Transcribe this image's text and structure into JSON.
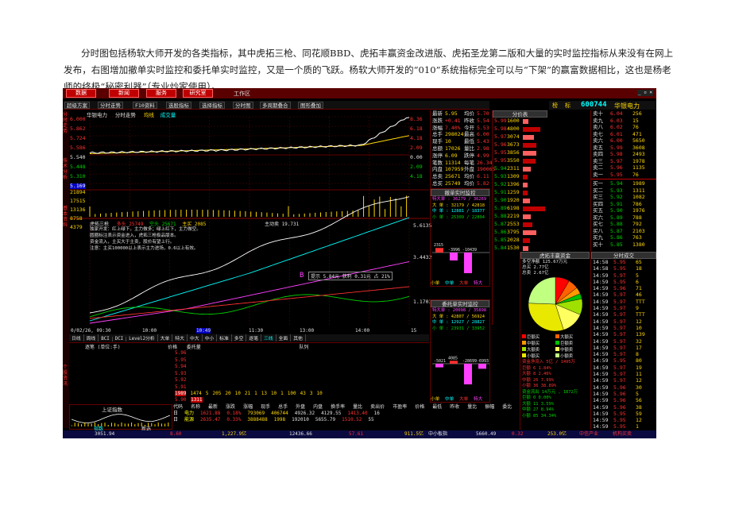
{
  "caption": "分时图包括杨软大师开发的各类指标，其中虎拓三枪、同花顺BBD、虎拓丰赢资金改进版、虎拓圣龙第二版和大量的实时监控指标从来没有在网上发布，右图增加撤单实时监控和委托单实时监控，又是一个质的飞跃。杨软大师开发的“010”系统指标完全可以与“下架”的赢富数据相比，这也是杨老师的终极“秘密利器”（专业炒家使用）。",
  "colors": {
    "up": "#ff3030",
    "down": "#00d000",
    "price": "#ffffff",
    "avg": "#ffd700",
    "volume": "#ffd700",
    "bg": "#000000"
  },
  "topbar": {
    "buttons": [
      "数据",
      "新闻",
      "服务",
      "研究室"
    ],
    "workspace": "工作区"
  },
  "stock": {
    "code": "600744",
    "name": "华银电力",
    "tabs": [
      "榜",
      "标"
    ]
  },
  "toolbar": [
    "超级方案",
    "分时走势",
    "F10资料",
    "选股指标",
    "选择指标",
    "分时图",
    "多周期叠合",
    "图形叠加"
  ],
  "chart_header": {
    "name": "华银电力",
    "mode": "分时走势",
    "tags": [
      "均线",
      "成交量"
    ]
  },
  "price_axis": {
    "left": [
      "6.000",
      "5.862",
      "5.724",
      "5.586",
      "5.448",
      "5.310",
      "5.169"
    ],
    "right": [
      "8.36",
      "6.18",
      "4.18",
      "2.09",
      "0.00",
      "2.09",
      "4.18"
    ],
    "current_left": "5.540",
    "current_right": "0.00",
    "volume": [
      "21894",
      "17515",
      "13136",
      "8758",
      "4379"
    ]
  },
  "indicator_header": {
    "label": "虎拓三枪",
    "items": [
      "多头 25749",
      "空头 25671",
      "主买 2085"
    ],
    "right_vals": [
      "3.4454",
      "主动卖 19.731"
    ]
  },
  "indicator_text": [
    "独家开发：红上绿下，主力做多；绿上红下，主力做空。",
    "圆圈标注表示资金进入，虎拓三枪极品版本。",
    "资金流入，主买大于主卖，股价有望上行。",
    "注意：主买100000以上表示主力进场，0.6以上有效。"
  ],
  "indicator_right_axis": [
    "5.6135",
    "3.4432",
    "1.1703",
    "0"
  ],
  "marker": {
    "letter": "B",
    "note": "提示 5.84元 获利 0.31元 占 21%"
  },
  "time_axis": [
    "0/02/26, 09:30",
    "10:00",
    "10:49",
    "11:30",
    "13:00",
    "14:00",
    "15"
  ],
  "bottom_tabs": [
    "日线",
    "周线",
    "BCI",
    "DCI",
    "Level2分析",
    "大单",
    "特大",
    "中大",
    "中小",
    "标准",
    "多空",
    "逐笔",
    "三线",
    "全面",
    "其他"
  ],
  "stats": [
    {
      "k": "最新",
      "v": "5.95",
      "k2": "均价",
      "v2": "5.70"
    },
    {
      "k": "涨跌",
      "v": "+0.41",
      "k2": "昨收",
      "v2": "5.54"
    },
    {
      "k": "涨幅",
      "v": "7.40%",
      "k2": "今开",
      "v2": "5.53"
    },
    {
      "k": "总手",
      "v": "298024",
      "k2": "最高",
      "v2": "6.00"
    },
    {
      "k": "现手",
      "v": "10",
      "k2": "最低",
      "v2": "5.43"
    },
    {
      "k": "总额",
      "v": "17026",
      "k2": "量比",
      "v2": "2.98"
    },
    {
      "k": "涨停",
      "v": "6.09",
      "k2": "跌停",
      "v2": "4.99"
    },
    {
      "k": "笔数",
      "v": "11314",
      "k2": "每笔",
      "v2": "26.34"
    },
    {
      "k": "内盘",
      "v": "107959",
      "k2": "外盘",
      "v2": "190065"
    },
    {
      "k": "总卖",
      "v": "25671",
      "k2": "均价",
      "v2": "6.11"
    },
    {
      "k": "总买",
      "v": "25749",
      "k2": "均价",
      "v2": "5.82"
    }
  ],
  "level_head": "分价表",
  "asks": [
    {
      "p": "5.99",
      "v": "1600"
    },
    {
      "p": "5.98",
      "v": "4800"
    },
    {
      "p": "5.97",
      "v": "3074"
    },
    {
      "p": "5.96",
      "v": "3673"
    },
    {
      "p": "5.95",
      "v": "3856"
    },
    {
      "p": "5.95",
      "v": "3550"
    }
  ],
  "bids": [
    {
      "p": "5.94",
      "v": "2311"
    },
    {
      "p": "5.93",
      "v": "1309"
    },
    {
      "p": "5.92",
      "v": "1396"
    },
    {
      "p": "5.91",
      "v": "1259"
    },
    {
      "p": "5.90",
      "v": "1920"
    },
    {
      "p": "5.89",
      "v": "6198"
    },
    {
      "p": "5.88",
      "v": "2219"
    },
    {
      "p": "5.87",
      "v": "2553"
    },
    {
      "p": "5.86",
      "v": "3795"
    },
    {
      "p": "5.85",
      "v": "2028"
    },
    {
      "p": "5.84",
      "v": "1530"
    }
  ],
  "orderbook": {
    "sell": [
      {
        "l": "卖十",
        "p": "6.04",
        "v": "256"
      },
      {
        "l": "卖九",
        "p": "6.03",
        "v": "15"
      },
      {
        "l": "卖八",
        "p": "6.02",
        "v": "76"
      },
      {
        "l": "卖七",
        "p": "6.01",
        "v": "471"
      },
      {
        "l": "卖六",
        "p": "6.00",
        "v": "5650"
      },
      {
        "l": "卖五",
        "p": "5.99",
        "v": "3608"
      },
      {
        "l": "卖四",
        "p": "5.98",
        "v": "2493"
      },
      {
        "l": "卖三",
        "p": "5.97",
        "v": "1978"
      },
      {
        "l": "卖二",
        "p": "5.96",
        "v": "1135"
      },
      {
        "l": "卖一",
        "p": "5.95",
        "v": "76"
      }
    ],
    "buy": [
      {
        "l": "买一",
        "p": "5.94",
        "v": "1989"
      },
      {
        "l": "买二",
        "p": "5.93",
        "v": "1311"
      },
      {
        "l": "买三",
        "p": "5.92",
        "v": "1082"
      },
      {
        "l": "买四",
        "p": "5.91",
        "v": "786"
      },
      {
        "l": "买五",
        "p": "5.90",
        "v": "1976"
      },
      {
        "l": "买六",
        "p": "5.89",
        "v": "788"
      },
      {
        "l": "买七",
        "p": "5.88",
        "v": "792"
      },
      {
        "l": "买八",
        "p": "5.87",
        "v": "2103"
      },
      {
        "l": "买九",
        "p": "5.86",
        "v": "763"
      },
      {
        "l": "买十",
        "p": "5.85",
        "v": "1380"
      }
    ]
  },
  "cancel_monitor": {
    "title": "撤单实时监控",
    "rows": [
      "特大单 : 36279 / 36269",
      "大 单 : 32179 / 42818",
      "中 单 : 12881 / 18377",
      "小 单 : 25309 / 22894"
    ],
    "bar_vals": [
      "2315",
      "-3996",
      "-10439"
    ],
    "bar_labels": [
      "小单",
      "中单",
      "大单",
      "特大"
    ]
  },
  "order_monitor": {
    "title": "委托单实时监控",
    "rows": [
      "特大单 : 20098 / 35898",
      "大 单 : 42807 / 56924",
      "中 单 : 12927 / 28827",
      "小 单 : 23931 / 33952"
    ],
    "bar_vals": [
      "-5021",
      "4085",
      "-28699",
      "-6993"
    ],
    "bar_labels": [
      "小单",
      "中单",
      "大单",
      "特大"
    ]
  },
  "fund_pie": {
    "title": "虎拓丰赢资金",
    "text": [
      "多空净额 125.67万元",
      "总买 2.77亿",
      "总卖 2.67亿"
    ],
    "legend": [
      "巨额买",
      "大额买",
      "中额买",
      "巨额卖",
      "大额卖",
      "中额卖",
      "小额买",
      "小额卖"
    ],
    "slices": [
      8.5,
      6.1,
      4.0,
      3.2,
      9.6,
      13.7,
      30.5,
      24.4
    ]
  },
  "fund_table": {
    "header": "资金净流入 5亿 / 1495万",
    "rows": [
      {
        "l": "巨额",
        "a": "6",
        "b": "1.84%"
      },
      {
        "l": "大额",
        "a": "8",
        "b": "2.46%"
      },
      {
        "l": "中额",
        "a": "26",
        "b": "7.99%"
      },
      {
        "l": "小额",
        "a": "36",
        "b": "38.89%"
      }
    ],
    "header2": "资金流出 14万元 , 1872万",
    "rows2": [
      {
        "l": "巨额",
        "a": "0",
        "b": "0.00%"
      },
      {
        "l": "大额",
        "a": "11",
        "b": "3.59%"
      },
      {
        "l": "中额",
        "a": "27",
        "b": "8.94%"
      },
      {
        "l": "小额",
        "a": "85",
        "b": "34.34%"
      }
    ]
  },
  "ticks_title": "分时成交",
  "ticks": [
    {
      "t": "14:58",
      "p": "5.95",
      "v": "65"
    },
    {
      "t": "14:58",
      "p": "5.95",
      "v": "18"
    },
    {
      "t": "14:59",
      "p": "5.97",
      "v": "5"
    },
    {
      "t": "14:59",
      "p": "5.95",
      "v": "6"
    },
    {
      "t": "14:59",
      "p": "5.96",
      "v": "71"
    },
    {
      "t": "14:59",
      "p": "5.97",
      "v": "46"
    },
    {
      "t": "14:59",
      "p": "5.97",
      "v": "TTT"
    },
    {
      "t": "14:59",
      "p": "5.97",
      "v": "9"
    },
    {
      "t": "14:59",
      "p": "5.97",
      "v": "TTT"
    },
    {
      "t": "14:59",
      "p": "5.97",
      "v": "12"
    },
    {
      "t": "14:59",
      "p": "5.97",
      "v": "10"
    },
    {
      "t": "14:59",
      "p": "5.97",
      "v": "139"
    },
    {
      "t": "14:59",
      "p": "5.97",
      "v": "32"
    },
    {
      "t": "14:59",
      "p": "5.97",
      "v": "17"
    },
    {
      "t": "14:59",
      "p": "5.97",
      "v": "8"
    },
    {
      "t": "14:59",
      "p": "5.95",
      "v": "80"
    },
    {
      "t": "14:59",
      "p": "5.97",
      "v": "19"
    },
    {
      "t": "14:59",
      "p": "5.97",
      "v": "11"
    },
    {
      "t": "14:59",
      "p": "5.97",
      "v": "12"
    },
    {
      "t": "14:59",
      "p": "5.96",
      "v": "30"
    },
    {
      "t": "14:59",
      "p": "5.96",
      "v": "5"
    },
    {
      "t": "14:59",
      "p": "5.96",
      "v": "56"
    },
    {
      "t": "14:59",
      "p": "5.96",
      "v": "38"
    },
    {
      "t": "14:59",
      "p": "5.95",
      "v": "59"
    },
    {
      "t": "14:59",
      "p": "5.95",
      "v": "12"
    },
    {
      "t": "14:59",
      "p": "5.95",
      "v": "1"
    }
  ],
  "depth": {
    "header": [
      "逐笔",
      "(单位:手)",
      "价格",
      "委托量",
      "队列",
      "买/卖"
    ],
    "prices": [
      "5.96",
      "5.95",
      "5.94",
      "5.93",
      "5.92",
      "5.91",
      "5.90"
    ],
    "queue_row": [
      "1989",
      "1474",
      "5",
      "205",
      "20",
      "10",
      "21",
      "1",
      "13",
      "10",
      "1",
      "100",
      "43",
      "3",
      "10"
    ],
    "queue_row2": [
      "1311"
    ],
    "tags": [
      "买一",
      "买二"
    ]
  },
  "index_panel": {
    "title": "上证指数",
    "value": "3051.94",
    "change": "8.60",
    "tab": "指数",
    "tab2": "新选"
  },
  "quote_table": {
    "headers": [
      "代码",
      "名称",
      "最新",
      "涨跌",
      "涨幅",
      "现手",
      "总手",
      "外盘",
      "内盘",
      "换手率",
      "量比",
      "卖出价",
      "市盈率",
      "价格",
      "最低",
      "昨收",
      "量比",
      "振幅",
      "委比"
    ],
    "rows": [
      {
        "mark": "日",
        "name": "电力",
        "v1": "1621.88",
        "v2": "0.18%",
        "v3": "793069",
        "v4": "406744",
        "v5": "4926.32",
        "v6": "4129.55",
        "v7": "1413.40",
        "v8": "16"
      },
      {
        "mark": "日",
        "name": "能源",
        "v1": "2635.47",
        "v2": "0.33%",
        "v3": "3888488",
        "v4": "1998",
        "v5": "192010",
        "v6": "5655.79",
        "v7": "1510.52",
        "v8": "55"
      }
    ]
  },
  "status_bar": {
    "items": [
      "1,227.9亿",
      "12436.66",
      "57.61",
      "911.5亿",
      "中小板指",
      "5660.49",
      "0.32",
      "253.0亿"
    ],
    "tabs": [
      "工作区",
      "分时",
      "个股",
      "指数",
      "平台",
      "综合",
      "平台",
      "热点",
      "板块"
    ],
    "bottom_right": [
      "中信产业",
      "机构买卖"
    ]
  },
  "side_labels": [
    "分时走势",
    "技术分析",
    "基本资料",
    "个股资讯"
  ]
}
